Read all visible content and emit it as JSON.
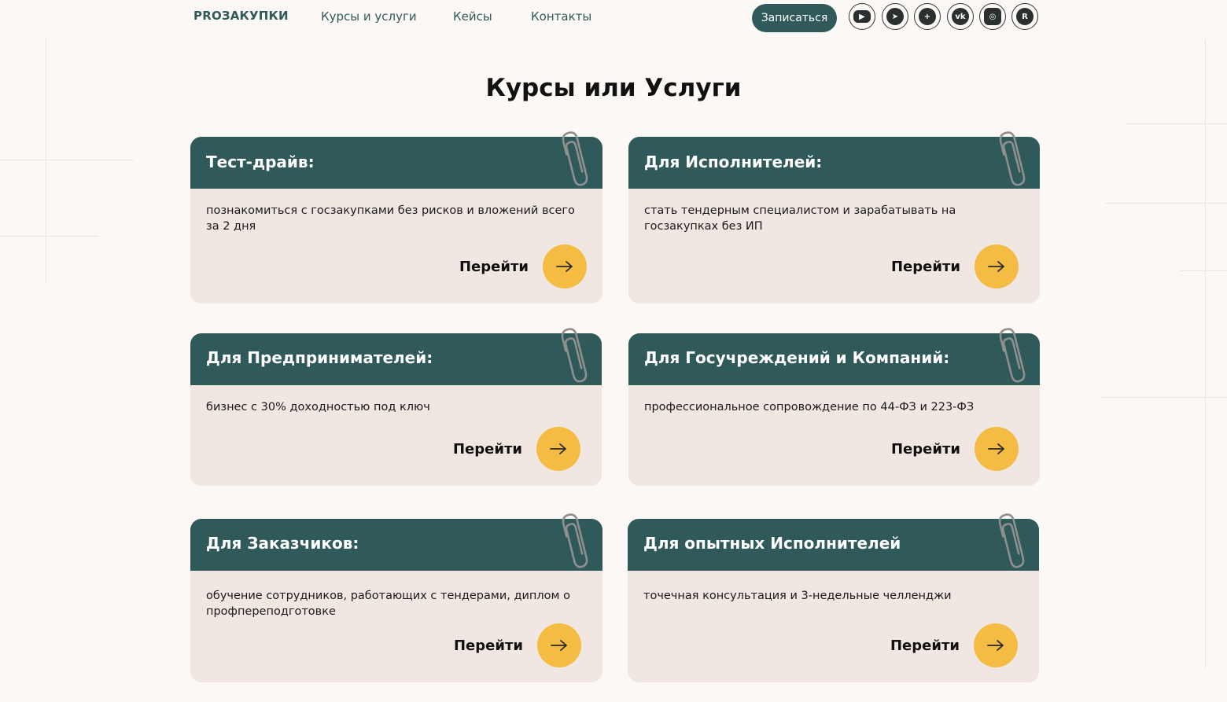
{
  "header": {
    "logo": "PROЗАКУПКИ",
    "nav": [
      "Курсы и услуги",
      "Кейсы",
      "Контакты"
    ],
    "signup_label": "Записаться",
    "social": [
      {
        "name": "youtube-icon",
        "glyph": "▶"
      },
      {
        "name": "telegram-icon",
        "glyph": "➤"
      },
      {
        "name": "plus-icon",
        "glyph": "+"
      },
      {
        "name": "vk-icon",
        "glyph": "vk"
      },
      {
        "name": "instagram-icon",
        "glyph": "◎"
      },
      {
        "name": "rutube-icon",
        "glyph": "R"
      }
    ]
  },
  "main": {
    "title": "Курсы или Услуги",
    "go_label": "Перейти",
    "cards": [
      {
        "title": "Тест-драйв:",
        "desc": "познакомиться с госзакупками без рисков и вложений всего за 2 дня"
      },
      {
        "title": "Для Исполнителей:",
        "desc": "стать тендерным специалистом и зарабатывать на госзакупках без ИП"
      },
      {
        "title": "Для Предпринимателей:",
        "desc": "бизнес с 30% доходностью под ключ"
      },
      {
        "title": "Для Госучреждений и Компаний:",
        "desc": "профессиональное сопровождение по 44-ФЗ и 223-ФЗ"
      },
      {
        "title": "Для Заказчиков:",
        "desc": "обучение сотрудников, работающих с тендерами, диплом о профпереподготовке"
      },
      {
        "title": "Для опытных Исполнителей",
        "desc": "точечная консультация и 3-недельные челленджи"
      }
    ]
  },
  "colors": {
    "primary": "#2f5a59",
    "accent": "#f5bc43",
    "card_bg": "#f0e6e2",
    "page_bg": "#fcf8f5"
  }
}
